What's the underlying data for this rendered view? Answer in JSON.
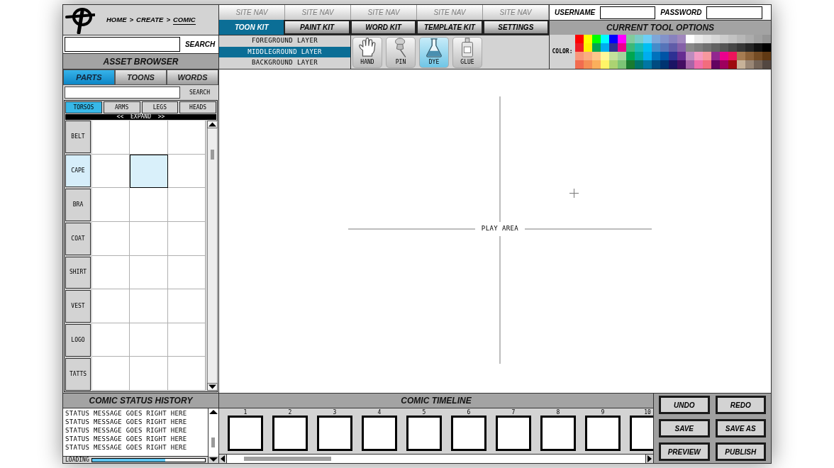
{
  "header": {
    "breadcrumb": {
      "separator": ">",
      "items": [
        {
          "label": "HOME",
          "selected": false
        },
        {
          "label": "CREATE",
          "selected": false
        },
        {
          "label": "COMIC",
          "selected": true
        }
      ]
    }
  },
  "site_nav": [
    {
      "label": "SITE NAV"
    },
    {
      "label": "SITE NAV"
    },
    {
      "label": "SITE NAV"
    },
    {
      "label": "SITE NAV"
    },
    {
      "label": "SITE NAV"
    }
  ],
  "login": {
    "username_label": "USERNAME",
    "password_label": "PASSWORD"
  },
  "kit_tabs": [
    {
      "label": "TOON KIT",
      "selected": true
    },
    {
      "label": "PAINT KIT",
      "selected": false
    },
    {
      "label": "WORD KIT",
      "selected": false
    },
    {
      "label": "TEMPLATE KIT",
      "selected": false
    },
    {
      "label": "SETTINGS",
      "selected": false
    }
  ],
  "tool_options": {
    "title": "CURRENT TOOL OPTIONS",
    "color_label": "COLOR:",
    "swatches": [
      {
        "color": "#ff0000"
      },
      {
        "color": "#ffff00"
      },
      {
        "color": "#00ff00"
      },
      {
        "color": "#00ffff"
      },
      {
        "color": "#0000ff"
      },
      {
        "color": "#ff00ff"
      },
      {
        "color": "#82ca9c"
      },
      {
        "color": "#7accc8"
      },
      {
        "color": "#6dcff6"
      },
      {
        "color": "#7ea7d8"
      },
      {
        "color": "#8393ca"
      },
      {
        "color": "#8882be"
      },
      {
        "color": "#a187be"
      },
      {
        "color": "#ffffff"
      },
      {
        "color": "#ebebeb"
      },
      {
        "color": "#e1e1e1"
      },
      {
        "color": "#d7d7d7"
      },
      {
        "color": "#cccccc"
      },
      {
        "color": "#c2c2c2"
      },
      {
        "color": "#b7b7b7"
      },
      {
        "color": "#acacac"
      },
      {
        "color": "#a0a0a0"
      },
      {
        "color": "#959595"
      },
      {
        "color": "#ed1c24"
      },
      {
        "color": "#fff200"
      },
      {
        "color": "#00a651"
      },
      {
        "color": "#00aeef"
      },
      {
        "color": "#2e3192"
      },
      {
        "color": "#ec008c"
      },
      {
        "color": "#3cb878"
      },
      {
        "color": "#1cbbb4"
      },
      {
        "color": "#00bff3"
      },
      {
        "color": "#448ccb"
      },
      {
        "color": "#5674b9"
      },
      {
        "color": "#605ca8"
      },
      {
        "color": "#8560a8"
      },
      {
        "color": "#898989"
      },
      {
        "color": "#7d7d7d"
      },
      {
        "color": "#707070"
      },
      {
        "color": "#626262"
      },
      {
        "color": "#555555"
      },
      {
        "color": "#464646"
      },
      {
        "color": "#363636"
      },
      {
        "color": "#262626"
      },
      {
        "color": "#111111"
      },
      {
        "color": "#000000"
      },
      {
        "color": "#f7977a"
      },
      {
        "color": "#f9ad81"
      },
      {
        "color": "#fdc68a"
      },
      {
        "color": "#fff79a"
      },
      {
        "color": "#c4df9b"
      },
      {
        "color": "#a3d39c"
      },
      {
        "color": "#00a650"
      },
      {
        "color": "#00a99d"
      },
      {
        "color": "#00adee"
      },
      {
        "color": "#0072bc"
      },
      {
        "color": "#0054a6"
      },
      {
        "color": "#2e3193"
      },
      {
        "color": "#662d91"
      },
      {
        "color": "#bd8cbf"
      },
      {
        "color": "#f49ac2"
      },
      {
        "color": "#f6989d"
      },
      {
        "color": "#92278f"
      },
      {
        "color": "#ec008d"
      },
      {
        "color": "#ed145b"
      },
      {
        "color": "#a67c52"
      },
      {
        "color": "#8c6239"
      },
      {
        "color": "#754c24"
      },
      {
        "color": "#603913"
      },
      {
        "color": "#f26c4f"
      },
      {
        "color": "#f68e55"
      },
      {
        "color": "#fbaf5c"
      },
      {
        "color": "#fff467"
      },
      {
        "color": "#acd372"
      },
      {
        "color": "#7cc576"
      },
      {
        "color": "#197b30"
      },
      {
        "color": "#00746b"
      },
      {
        "color": "#0076a3"
      },
      {
        "color": "#004b80"
      },
      {
        "color": "#003471"
      },
      {
        "color": "#1b1464"
      },
      {
        "color": "#440e62"
      },
      {
        "color": "#a864a8"
      },
      {
        "color": "#f06eaa"
      },
      {
        "color": "#f26d7d"
      },
      {
        "color": "#630460"
      },
      {
        "color": "#9e005d"
      },
      {
        "color": "#9e0b0f"
      },
      {
        "color": "#c7b299"
      },
      {
        "color": "#998675"
      },
      {
        "color": "#736357"
      },
      {
        "color": "#534741"
      }
    ]
  },
  "search": {
    "button": "SEARCH"
  },
  "layers": [
    {
      "label": "FOREGROUND LAYER",
      "selected": false
    },
    {
      "label": "MIDDLEGROUND LAYER",
      "selected": true
    },
    {
      "label": "BACKGROUND LAYER",
      "selected": false
    }
  ],
  "tools": [
    {
      "label": "HAND",
      "selected": false
    },
    {
      "label": "PIN",
      "selected": false
    },
    {
      "label": "DYE",
      "selected": true
    },
    {
      "label": "GLUE",
      "selected": false
    }
  ],
  "asset_browser": {
    "title": "ASSET BROWSER",
    "tabs": [
      {
        "label": "PARTS",
        "selected": true
      },
      {
        "label": "TOONS",
        "selected": false
      },
      {
        "label": "WORDS",
        "selected": false
      }
    ],
    "search_button": "SEARCH",
    "part_tabs": [
      {
        "label": "TORSOS",
        "selected": true
      },
      {
        "label": "ARMS",
        "selected": false
      },
      {
        "label": "LEGS",
        "selected": false
      },
      {
        "label": "HEADS",
        "selected": false
      }
    ],
    "expand": "<< EXPAND >>",
    "categories": [
      {
        "label": "BELT",
        "selected": false
      },
      {
        "label": "CAPE",
        "selected": true
      },
      {
        "label": "BRA",
        "selected": false
      },
      {
        "label": "COAT",
        "selected": false
      },
      {
        "label": "SHIRT",
        "selected": false
      },
      {
        "label": "VEST",
        "selected": false
      },
      {
        "label": "LOGO",
        "selected": false
      },
      {
        "label": "TATTS",
        "selected": false
      }
    ],
    "slots": [
      {
        "selected": false
      },
      {
        "selected": false
      },
      {
        "selected": false
      },
      {
        "selected": false
      },
      {
        "selected": true
      },
      {
        "selected": false
      },
      {
        "selected": false
      },
      {
        "selected": false
      },
      {
        "selected": false
      },
      {
        "selected": false
      },
      {
        "selected": false
      },
      {
        "selected": false
      },
      {
        "selected": false
      },
      {
        "selected": false
      },
      {
        "selected": false
      },
      {
        "selected": false
      },
      {
        "selected": false
      },
      {
        "selected": false
      },
      {
        "selected": false
      },
      {
        "selected": false
      },
      {
        "selected": false
      },
      {
        "selected": false
      },
      {
        "selected": false
      },
      {
        "selected": false
      }
    ]
  },
  "play_area": {
    "label": "PLAY AREA"
  },
  "status_history": {
    "title": "COMIC STATUS HISTORY",
    "messages": [
      "STATUS MESSAGE GOES RIGHT HERE",
      "STATUS MESSAGE GOES RIGHT HERE",
      "STATUS MESSAGE GOES RIGHT HERE",
      "STATUS MESSAGE GOES RIGHT HERE",
      "STATUS MESSAGE GOES RIGHT HERE"
    ],
    "loading": {
      "label": "LOADING",
      "level": 0.65
    }
  },
  "timeline": {
    "title": "COMIC TIMELINE",
    "frames": [
      {
        "number": "1"
      },
      {
        "number": "2"
      },
      {
        "number": "3"
      },
      {
        "number": "4"
      },
      {
        "number": "5"
      },
      {
        "number": "6"
      },
      {
        "number": "7"
      },
      {
        "number": "8"
      },
      {
        "number": "9"
      },
      {
        "number": "10"
      }
    ]
  },
  "actions": [
    {
      "label": "UNDO"
    },
    {
      "label": "REDO"
    },
    {
      "label": "SAVE"
    },
    {
      "label": "SAVE AS"
    },
    {
      "label": "PREVIEW"
    },
    {
      "label": "PUBLISH"
    }
  ]
}
